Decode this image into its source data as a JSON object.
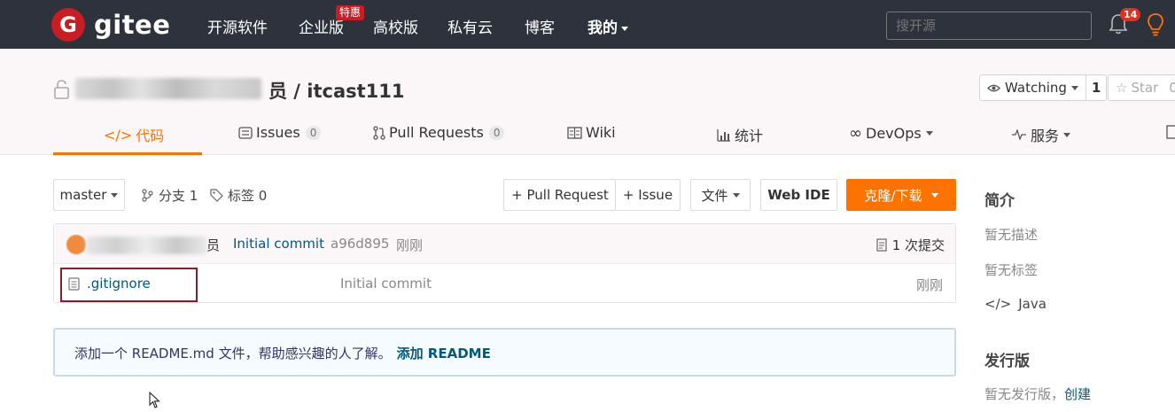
{
  "nav": {
    "logo_letter": "G",
    "logo_text": "gitee",
    "links": [
      {
        "label": "开源软件"
      },
      {
        "label": "企业版",
        "badge": "特惠"
      },
      {
        "label": "高校版"
      },
      {
        "label": "私有云"
      },
      {
        "label": "博客"
      },
      {
        "label": "我的"
      }
    ],
    "search_placeholder": "搜开源",
    "notification_count": "14"
  },
  "repo": {
    "name_tail": "员 / itcast111",
    "watch_label": "Watching",
    "watch_count": "1",
    "star_label": "Star",
    "star_count": "0"
  },
  "tabs": [
    {
      "label": "代码",
      "icon": "code-icon",
      "active": true
    },
    {
      "label": "Issues",
      "icon": "issues-icon",
      "count": "0"
    },
    {
      "label": "Pull Requests",
      "icon": "pull-request-icon",
      "count": "0"
    },
    {
      "label": "Wiki",
      "icon": "wiki-icon"
    },
    {
      "label": "统计",
      "icon": "stats-icon"
    },
    {
      "label": "DevOps",
      "icon": "devops-icon"
    },
    {
      "label": "服务",
      "icon": "service-icon"
    }
  ],
  "toolbar": {
    "branch": "master",
    "branches": "分支 1",
    "tags": "标签 0",
    "pull_request": "+ Pull Request",
    "issue": "+ Issue",
    "file": "文件",
    "web_ide": "Web IDE",
    "clone": "克隆/下载"
  },
  "commit": {
    "author_tail": "员",
    "message": "Initial commit",
    "hash": "a96d895",
    "time": "刚刚",
    "count": "1 次提交"
  },
  "files": [
    {
      "name": ".gitignore",
      "message": "Initial commit",
      "time": "刚刚"
    }
  ],
  "readme": {
    "text": "添加一个 README.md 文件，帮助感兴趣的人了解。",
    "link": "添加 README"
  },
  "sidebar": {
    "intro_title": "简介",
    "no_desc": "暂无描述",
    "no_tags": "暂无标签",
    "language": "Java",
    "release_title": "发行版",
    "no_release": "暂无发行版，",
    "create_link": "创建"
  },
  "colors": {
    "nav_bg": "#2e323c",
    "brand_red": "#c71d23",
    "accent_orange": "#fe7300",
    "link_blue": "#005980"
  }
}
